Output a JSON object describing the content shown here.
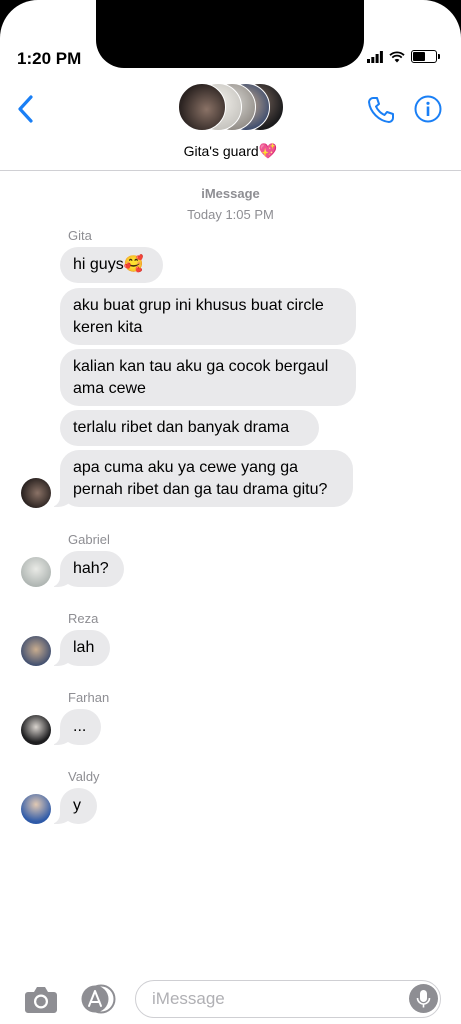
{
  "status_bar": {
    "time": "1:20 PM"
  },
  "header": {
    "group_name": "Gita's guard",
    "group_emoji": "💖"
  },
  "thread": {
    "service_label": "iMessage",
    "timestamp": "Today 1:05 PM"
  },
  "groups": [
    {
      "sender": "Gita",
      "messages": [
        {
          "text": "hi guys🥰"
        },
        {
          "text": "aku buat grup ini khusus buat circle keren kita"
        },
        {
          "text": "kalian kan tau aku ga cocok bergaul ama cewe"
        },
        {
          "text": "terlalu ribet dan banyak drama"
        },
        {
          "text": "apa cuma aku ya cewe yang ga pernah ribet dan ga tau drama gitu?"
        }
      ]
    },
    {
      "sender": "Gabriel",
      "messages": [
        {
          "text": "hah?"
        }
      ]
    },
    {
      "sender": "Reza",
      "messages": [
        {
          "text": "lah"
        }
      ]
    },
    {
      "sender": "Farhan",
      "messages": [
        {
          "text": "..."
        }
      ]
    },
    {
      "sender": "Valdy",
      "messages": [
        {
          "text": "y"
        }
      ]
    }
  ],
  "composer": {
    "placeholder": "iMessage"
  },
  "colors": {
    "accent": "#1a7ff5",
    "bubble": "#e9e9eb",
    "meta_text": "#8e8e93"
  },
  "icons": [
    "back-chevron-icon",
    "phone-icon",
    "info-icon",
    "camera-icon",
    "app-store-icon",
    "microphone-icon",
    "signal-icon",
    "wifi-icon",
    "battery-icon"
  ]
}
